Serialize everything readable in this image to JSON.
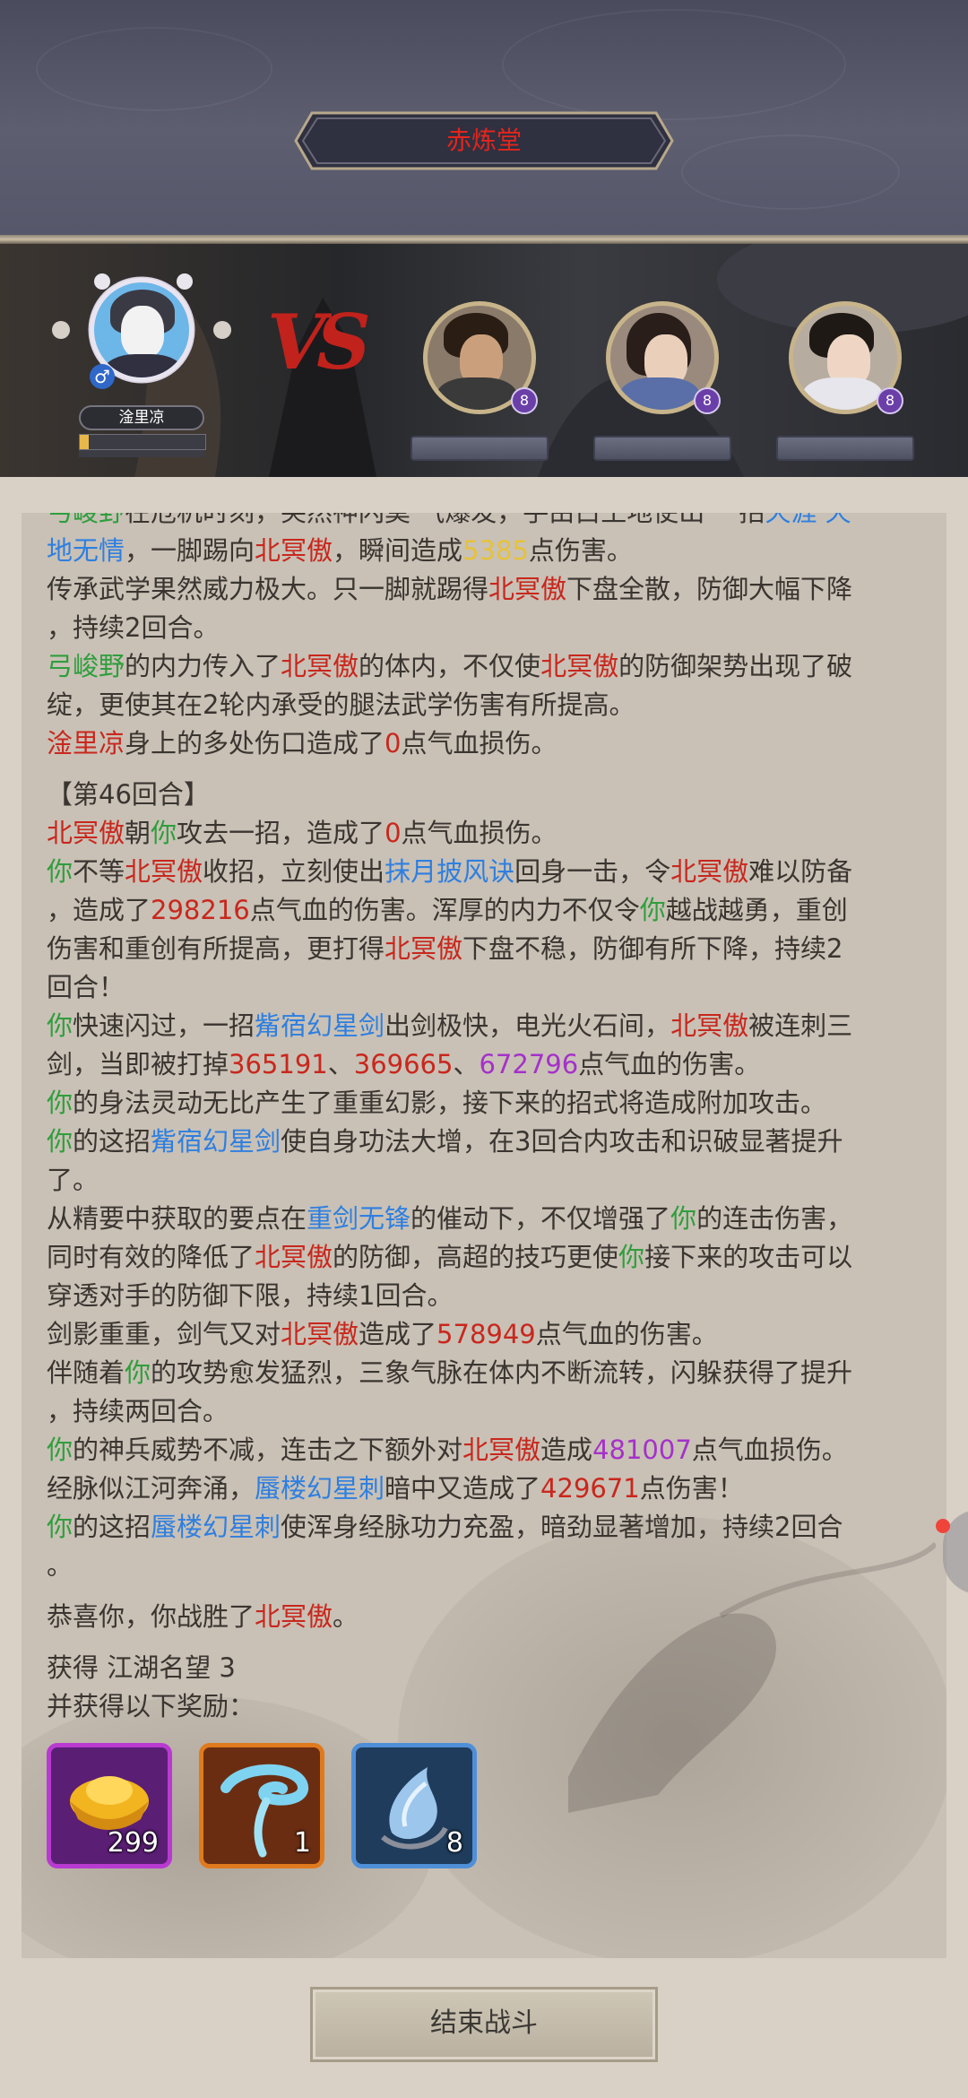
{
  "header": {
    "title": "赤炼堂"
  },
  "player": {
    "name": "淦里凉",
    "gender_icon": "male-icon"
  },
  "battle": {
    "vs_label": "VS"
  },
  "enemies": [
    {
      "name": "",
      "rank": "8"
    },
    {
      "name": "",
      "rank": "8"
    },
    {
      "name": "",
      "rank": "8"
    }
  ],
  "log": [
    [
      [
        "g",
        "弓峻野"
      ],
      [
        "",
        "在危机时刻，突然神闪莫  气爆发，手由白土地使出  一招"
      ],
      [
        "b",
        "天涯  天"
      ]
    ],
    [
      [
        "b",
        "地无情"
      ],
      [
        "",
        "，一脚踢向"
      ],
      [
        "r",
        "北冥傲"
      ],
      [
        "",
        "，瞬间造成"
      ],
      [
        "y",
        "5385"
      ],
      [
        "",
        "点伤害。"
      ]
    ],
    [
      [
        "",
        "传承武学果然威力极大。只一脚就踢得"
      ],
      [
        "r",
        "北冥傲"
      ],
      [
        "",
        "下盘全散，防御大幅下降"
      ]
    ],
    [
      [
        "",
        "，持续2回合。"
      ]
    ],
    [
      [
        "g",
        "弓峻野"
      ],
      [
        "",
        "的内力传入了"
      ],
      [
        "r",
        "北冥傲"
      ],
      [
        "",
        "的体内，不仅使"
      ],
      [
        "r",
        "北冥傲"
      ],
      [
        "",
        "的防御架势出现了破"
      ]
    ],
    [
      [
        "",
        "绽，更使其在2轮内承受的腿法武学伤害有所提高。"
      ]
    ],
    [
      [
        "r",
        "淦里凉"
      ],
      [
        "",
        "身上的多处伤口造成了"
      ],
      [
        "r",
        "0"
      ],
      [
        "",
        "点气血损伤。"
      ]
    ],
    "gap",
    [
      [
        "",
        "【第46回合】"
      ]
    ],
    [
      [
        "r",
        "北冥傲"
      ],
      [
        "",
        "朝"
      ],
      [
        "g",
        "你"
      ],
      [
        "",
        "攻去一招，造成了"
      ],
      [
        "r",
        "0"
      ],
      [
        "",
        "点气血损伤。"
      ]
    ],
    [
      [
        "g",
        "你"
      ],
      [
        "",
        "不等"
      ],
      [
        "r",
        "北冥傲"
      ],
      [
        "",
        "收招，立刻使出"
      ],
      [
        "b",
        "抹月披风诀"
      ],
      [
        "",
        "回身一击，令"
      ],
      [
        "r",
        "北冥傲"
      ],
      [
        "",
        "难以防备"
      ]
    ],
    [
      [
        "",
        "，造成了"
      ],
      [
        "r",
        "298216"
      ],
      [
        "",
        "点气血的伤害。浑厚的内力不仅令"
      ],
      [
        "g",
        "你"
      ],
      [
        "",
        "越战越勇，重创"
      ]
    ],
    [
      [
        "",
        "伤害和重创有所提高，更打得"
      ],
      [
        "r",
        "北冥傲"
      ],
      [
        "",
        "下盘不稳，防御有所下降，持续2"
      ]
    ],
    [
      [
        "",
        "回合！"
      ]
    ],
    [
      [
        "g",
        "你"
      ],
      [
        "",
        "快速闪过，一招"
      ],
      [
        "b",
        "觜宿幻星剑"
      ],
      [
        "",
        "出剑极快，电光火石间，"
      ],
      [
        "r",
        "北冥傲"
      ],
      [
        "",
        "被连刺三"
      ]
    ],
    [
      [
        "",
        "剑，当即被打掉"
      ],
      [
        "r",
        "365191"
      ],
      [
        "",
        "、"
      ],
      [
        "r",
        "369665"
      ],
      [
        "",
        "、"
      ],
      [
        "pu",
        "672796"
      ],
      [
        "",
        "点气血的伤害。"
      ]
    ],
    [
      [
        "g",
        "你"
      ],
      [
        "",
        "的身法灵动无比产生了重重幻影，接下来的招式将造成附加攻击。"
      ]
    ],
    [
      [
        "g",
        "你"
      ],
      [
        "",
        "的这招"
      ],
      [
        "b",
        "觜宿幻星剑"
      ],
      [
        "",
        "使自身功法大增，在3回合内攻击和识破显著提升"
      ]
    ],
    [
      [
        "",
        "了。"
      ]
    ],
    [
      [
        "",
        "从精要中获取的要点在"
      ],
      [
        "b",
        "重剑无锋"
      ],
      [
        "",
        "的催动下，不仅增强了"
      ],
      [
        "g",
        "你"
      ],
      [
        "",
        "的连击伤害，"
      ]
    ],
    [
      [
        "",
        "同时有效的降低了"
      ],
      [
        "r",
        "北冥傲"
      ],
      [
        "",
        "的防御，高超的技巧更使"
      ],
      [
        "g",
        "你"
      ],
      [
        "",
        "接下来的攻击可以"
      ]
    ],
    [
      [
        "",
        "穿透对手的防御下限，持续1回合。"
      ]
    ],
    [
      [
        "",
        "剑影重重，剑气又对"
      ],
      [
        "r",
        "北冥傲"
      ],
      [
        "",
        "造成了"
      ],
      [
        "r",
        "578949"
      ],
      [
        "",
        "点气血的伤害。"
      ]
    ],
    [
      [
        "",
        "伴随着"
      ],
      [
        "g",
        "你"
      ],
      [
        "",
        "的攻势愈发猛烈，三象气脉在体内不断流转，闪躲获得了提升"
      ]
    ],
    [
      [
        "",
        "，持续两回合。"
      ]
    ],
    [
      [
        "g",
        "你"
      ],
      [
        "",
        "的神兵威势不减，连击之下额外对"
      ],
      [
        "r",
        "北冥傲"
      ],
      [
        "",
        "造成"
      ],
      [
        "pu",
        "481007"
      ],
      [
        "",
        "点气血损伤。"
      ]
    ],
    [
      [
        "",
        "经脉似江河奔涌，"
      ],
      [
        "b",
        "蜃楼幻星刺"
      ],
      [
        "",
        "暗中又造成了"
      ],
      [
        "r",
        "429671"
      ],
      [
        "",
        "点伤害！"
      ]
    ],
    [
      [
        "g",
        "你"
      ],
      [
        "",
        "的这招"
      ],
      [
        "b",
        "蜃楼幻星刺"
      ],
      [
        "",
        "使浑身经脉功力充盈，暗劲显著增加，持续2回合"
      ]
    ],
    [
      [
        "",
        "。"
      ]
    ],
    "gap",
    [
      [
        "",
        "恭喜你，你战胜了"
      ],
      [
        "r",
        "北冥傲"
      ],
      [
        "",
        "。"
      ]
    ],
    "gap",
    [
      [
        "",
        "获得  江湖名望  3"
      ]
    ],
    [
      [
        "",
        "并获得以下奖励："
      ]
    ]
  ],
  "rewards": [
    {
      "name": "gold-ingot-icon",
      "count": "299",
      "frame": "#b93ad1",
      "bg": "#5b1e75"
    },
    {
      "name": "blue-cloud-scarf-icon",
      "count": "1",
      "frame": "#e07a1e",
      "bg": "#6b2d12"
    },
    {
      "name": "blue-crystal-shard-icon",
      "count": "8",
      "frame": "#4f8fd8",
      "bg": "#1f3c5c"
    }
  ],
  "footer": {
    "end_button": "结束战斗"
  }
}
